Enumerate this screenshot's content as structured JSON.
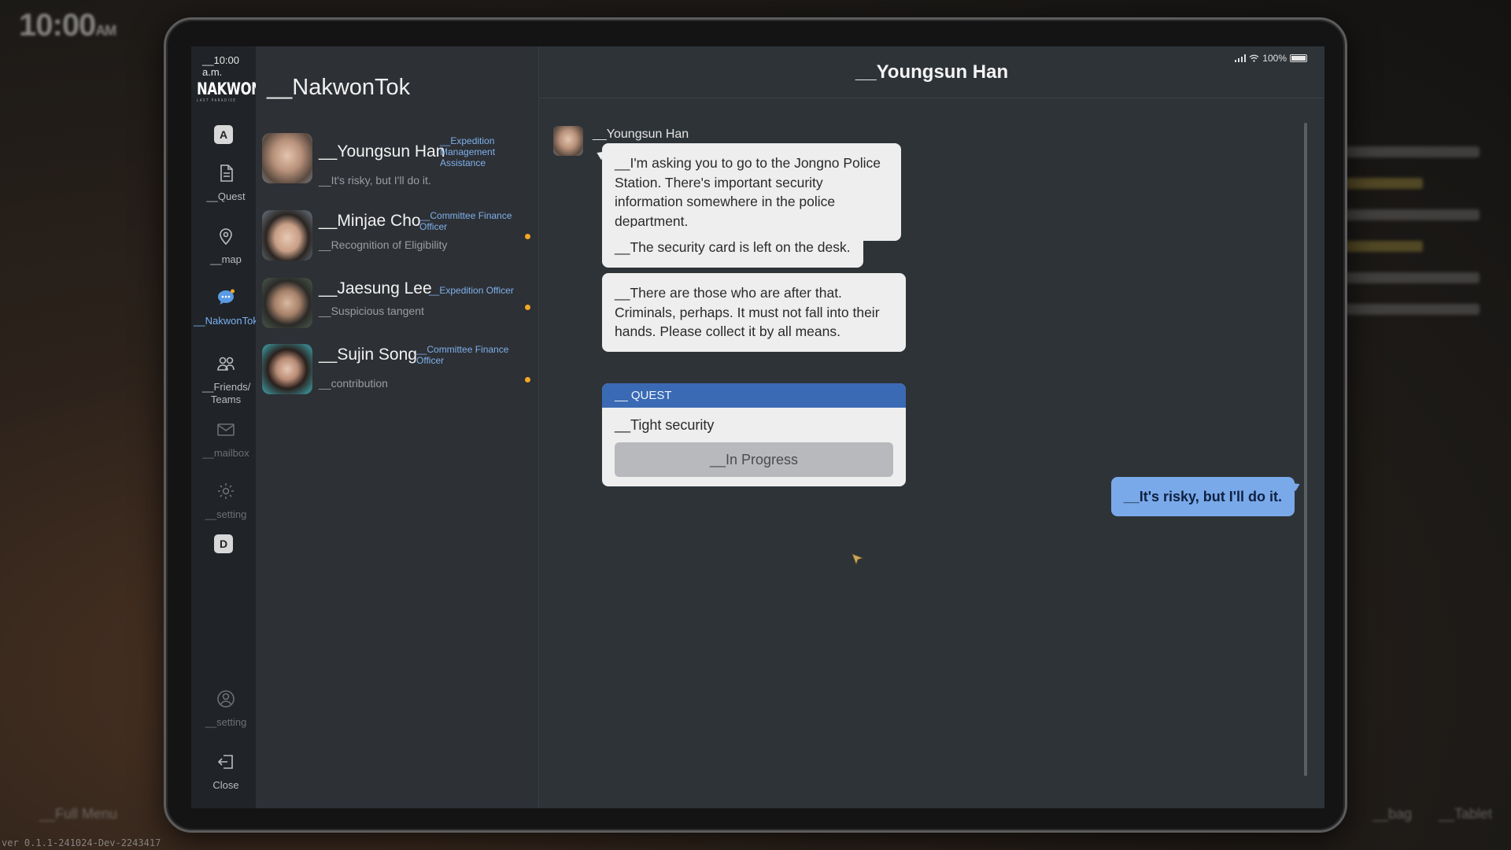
{
  "background": {
    "clock": "10:00",
    "clock_suffix": "AM",
    "version": "ver 0.1.1-241024-Dev-2243417",
    "full_menu": "__Full Menu",
    "bag": "__bag",
    "tablet": "__Tablet"
  },
  "device": {
    "time": "__10:00 a.m.",
    "battery": "100%"
  },
  "rail": {
    "logo": "NAKWON",
    "key_top": "A",
    "key_bottom": "D",
    "items": [
      {
        "label": "__Quest"
      },
      {
        "label": "__map"
      },
      {
        "label": "__NakwonTok"
      },
      {
        "label": "__Friends/ Teams"
      },
      {
        "label": "__mailbox"
      },
      {
        "label": "__setting"
      },
      {
        "label": "__setting"
      },
      {
        "label": "Close"
      }
    ]
  },
  "list": {
    "title": "__NakwonTok",
    "contacts": [
      {
        "name": "__Youngsun Han",
        "role": "__Expedition Management Assistance",
        "last": "__It's risky, but I'll do it.",
        "unread": false
      },
      {
        "name": "__Minjae Cho",
        "role": "__Committee Finance Officer",
        "last": "__Recognition of Eligibility",
        "unread": true
      },
      {
        "name": "__Jaesung Lee",
        "role": "__Expedition Officer",
        "last": "__Suspicious tangent",
        "unread": true
      },
      {
        "name": "__Sujin Song",
        "role": "__Committee Finance Officer",
        "last": "__contribution",
        "unread": true
      }
    ]
  },
  "conversation": {
    "title": "__Youngsun Han",
    "sender": "__Youngsun Han",
    "messages": [
      "__I'm asking you to go to the Jongno Police Station. There's important security information somewhere in the police department.",
      "__The security card is left on the desk.",
      "__There are those who are after that. Criminals, perhaps. It must not fall into their hands. Please collect it by all means."
    ],
    "quest": {
      "header": "__ QUEST",
      "name": "__Tight security",
      "status": "__In Progress"
    },
    "reply": "__It's risky, but I'll do it."
  },
  "colors": {
    "accent": "#79b0f2",
    "quest_header": "#3a6ab4",
    "reply_bubble": "#7aa9ea",
    "unread_dot": "#f0a825"
  }
}
